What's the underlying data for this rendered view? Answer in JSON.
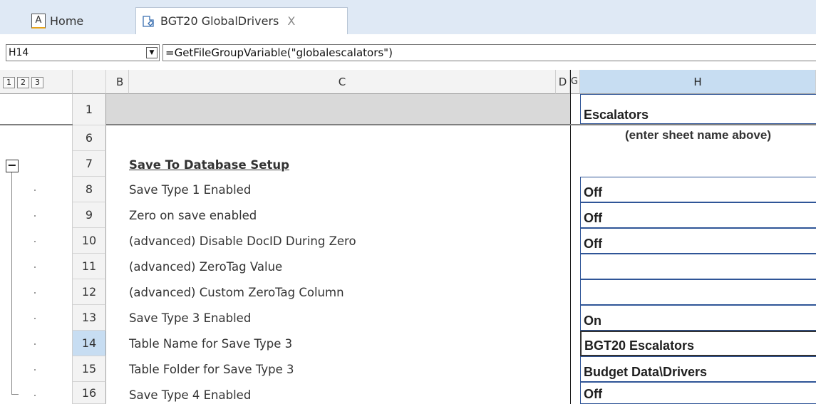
{
  "tabs": {
    "home_label": "Home",
    "home_icon_letter": "A",
    "doc_label": "BGT20 GlobalDrivers",
    "close_glyph": "X"
  },
  "formula_bar": {
    "name_box": "H14",
    "formula": "=GetFileGroupVariable(\"globalescalators\")"
  },
  "columns": {
    "outline_levels": [
      "1",
      "2",
      "3"
    ],
    "b": "B",
    "c": "C",
    "d": "D",
    "g": "G",
    "h": "H"
  },
  "rows": [
    {
      "num": "1",
      "label": "",
      "value": "Escalators"
    },
    {
      "num": "6",
      "label": "",
      "value": "(enter sheet name above)"
    },
    {
      "num": "7",
      "label": "Save To Database Setup",
      "value": ""
    },
    {
      "num": "8",
      "label": "Save Type 1 Enabled",
      "value": "Off"
    },
    {
      "num": "9",
      "label": "Zero on save enabled",
      "value": "Off"
    },
    {
      "num": "10",
      "label": "(advanced) Disable DocID During Zero",
      "value": "Off"
    },
    {
      "num": "11",
      "label": "(advanced) ZeroTag Value",
      "value": ""
    },
    {
      "num": "12",
      "label": "(advanced) Custom ZeroTag Column",
      "value": ""
    },
    {
      "num": "13",
      "label": "Save Type 3 Enabled",
      "value": "On"
    },
    {
      "num": "14",
      "label": "Table Name for Save Type 3",
      "value": "BGT20  Escalators"
    },
    {
      "num": "15",
      "label": "Table Folder for Save Type 3",
      "value": "Budget Data\\Drivers"
    },
    {
      "num": "16",
      "label": "Save Type 4 Enabled",
      "value": "Off"
    }
  ],
  "outline": {
    "collapse_glyph": "−"
  },
  "colors": {
    "selected_header": "#c7ddf2",
    "cell_border": "#2f5597",
    "band_gray": "#d9d9d9"
  }
}
